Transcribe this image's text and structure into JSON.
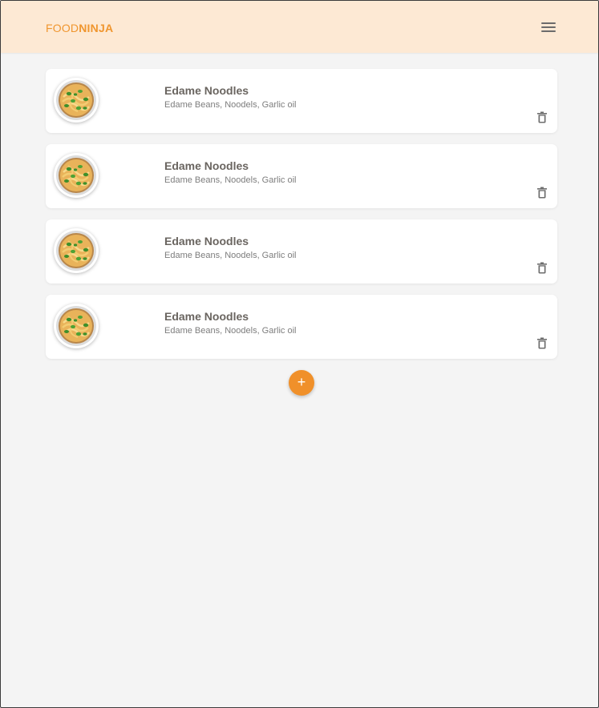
{
  "header": {
    "logo_part1": "FOOD",
    "logo_part2": "NINJA",
    "menu_icon": "hamburger-menu-icon",
    "accent_color": "#f0962f",
    "background_color": "#fde9d4"
  },
  "recipes": [
    {
      "title": "Edame Noodles",
      "ingredients": "Edame Beans, Noodels, Garlic oil",
      "image_icon": "noodle-bowl-icon",
      "action_icon": "trash-icon"
    },
    {
      "title": "Edame Noodles",
      "ingredients": "Edame Beans, Noodels, Garlic oil",
      "image_icon": "noodle-bowl-icon",
      "action_icon": "trash-icon"
    },
    {
      "title": "Edame Noodles",
      "ingredients": "Edame Beans, Noodels, Garlic oil",
      "image_icon": "noodle-bowl-icon",
      "action_icon": "trash-icon"
    },
    {
      "title": "Edame Noodles",
      "ingredients": "Edame Beans, Noodels, Garlic oil",
      "image_icon": "noodle-bowl-icon",
      "action_icon": "trash-icon"
    }
  ],
  "fab": {
    "label": "+",
    "icon": "plus-icon",
    "color": "#f0902a"
  }
}
